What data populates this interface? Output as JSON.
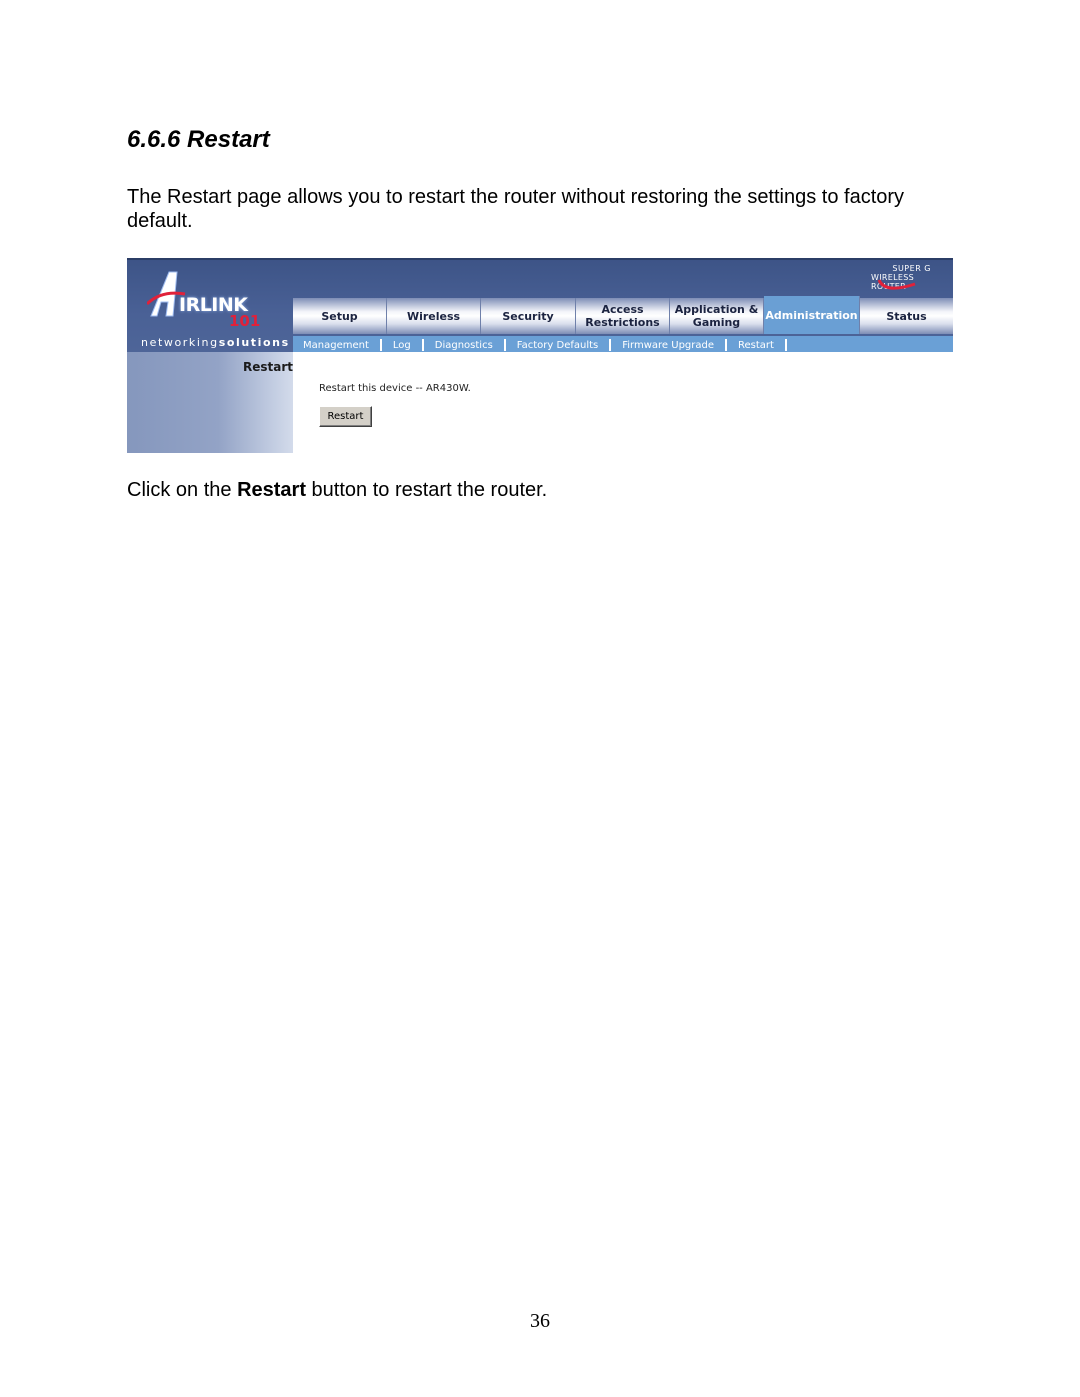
{
  "document": {
    "heading": "6.6.6 Restart",
    "intro": "The Restart page allows you to restart the router without restoring the settings to factory default.",
    "instruction": {
      "prefix": "Click on the ",
      "bold": "Restart",
      "suffix": " button to restart the router."
    },
    "page_number": "36"
  },
  "router_ui": {
    "brand": {
      "logo_text": "IRLINK",
      "logo_number": "101",
      "tagline_light": "networking",
      "tagline_bold": "solutions",
      "badge_line1": "SUPER G",
      "badge_line2": "WIRELESS ROUTER"
    },
    "main_tabs": [
      {
        "label": "Setup",
        "active": false
      },
      {
        "label": "Wireless",
        "active": false
      },
      {
        "label": "Security",
        "active": false
      },
      {
        "label": "Access Restrictions",
        "active": false
      },
      {
        "label": "Application & Gaming",
        "active": false
      },
      {
        "label": "Administration",
        "active": true
      },
      {
        "label": "Status",
        "active": false
      }
    ],
    "sub_tabs": [
      {
        "label": "Management"
      },
      {
        "label": "Log"
      },
      {
        "label": "Diagnostics"
      },
      {
        "label": "Factory Defaults"
      },
      {
        "label": "Firmware Upgrade"
      },
      {
        "label": "Restart"
      }
    ],
    "section_title": "Restart",
    "description": "Restart this device -- AR430W.",
    "button_label": "Restart"
  },
  "colors": {
    "header_blue": "#4a6196",
    "active_tab": "#6a9fd4",
    "subnav": "#6aa0d6",
    "logo_red": "#e0213a"
  }
}
